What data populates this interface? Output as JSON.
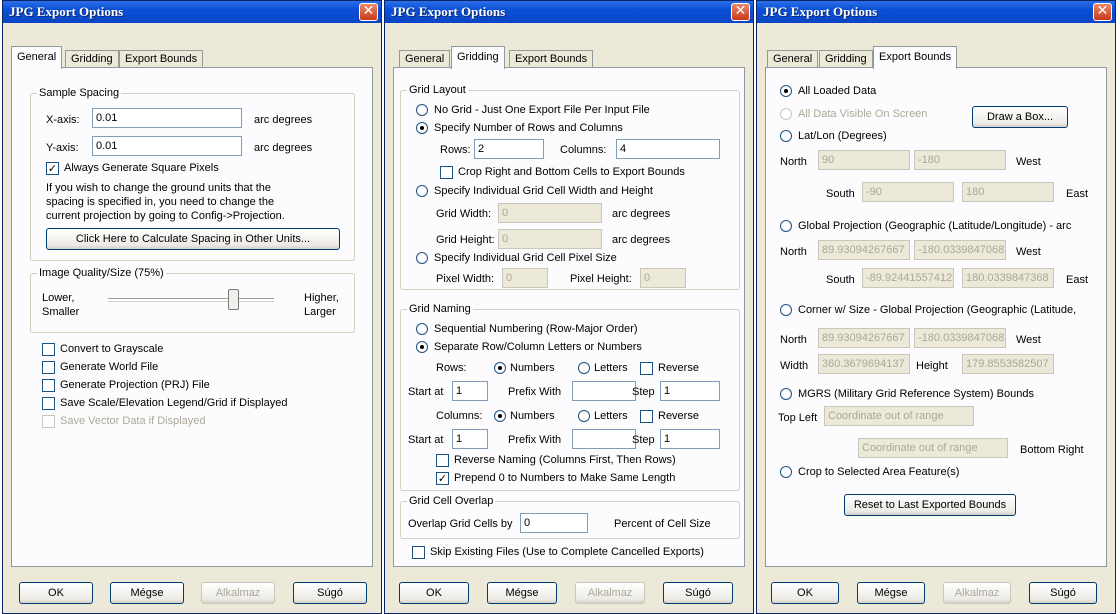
{
  "dialog_title": "JPG Export Options",
  "tabs": [
    "General",
    "Gridding",
    "Export Bounds"
  ],
  "footer": {
    "ok": "OK",
    "cancel": "Mégse",
    "apply": "Alkalmaz",
    "help": "Súgó"
  },
  "general": {
    "sample_spacing": {
      "group": "Sample Spacing",
      "x_label": "X-axis:",
      "x_value": "0.01",
      "x_unit": "arc degrees",
      "y_label": "Y-axis:",
      "y_value": "0.01",
      "y_unit": "arc degrees",
      "square_pixels": "Always Generate Square Pixels",
      "note_1": "If you wish to change the ground units that the",
      "note_2": "spacing is specified in, you need to change the",
      "note_3": "current projection by going to Config->Projection.",
      "calc_button": "Click Here to Calculate Spacing in Other Units..."
    },
    "quality": {
      "group": "Image Quality/Size (75%)",
      "level": 0.75,
      "low_1": "Lower,",
      "low_2": "Smaller",
      "high_1": "Higher,",
      "high_2": "Larger"
    },
    "options": [
      {
        "label": "Convert to Grayscale",
        "checked": false,
        "disabled": false
      },
      {
        "label": "Generate World File",
        "checked": false,
        "disabled": false
      },
      {
        "label": "Generate Projection (PRJ) File",
        "checked": false,
        "disabled": false
      },
      {
        "label": "Save Scale/Elevation Legend/Grid if Displayed",
        "checked": false,
        "disabled": false
      },
      {
        "label": "Save Vector Data if Displayed",
        "checked": false,
        "disabled": true
      }
    ]
  },
  "gridding": {
    "layout": {
      "group": "Grid Layout",
      "no_grid": "No Grid - Just One Export File Per Input File",
      "rows_cols": "Specify Number of Rows and Columns",
      "rows_label": "Rows:",
      "rows_value": "2",
      "cols_label": "Columns:",
      "cols_value": "4",
      "crop": "Crop Right and Bottom Cells to Export Bounds",
      "cell_size": "Specify Individual Grid Cell Width and Height",
      "gw_label": "Grid Width:",
      "gw_value": "0",
      "gw_unit": "arc degrees",
      "gh_label": "Grid Height:",
      "gh_value": "0",
      "gh_unit": "arc degrees",
      "pixel_size": "Specify Individual Grid Cell Pixel Size",
      "pw_label": "Pixel Width:",
      "pw_value": "0",
      "ph_label": "Pixel Height:",
      "ph_value": "0"
    },
    "naming": {
      "group": "Grid Naming",
      "sequential": "Sequential Numbering (Row-Major Order)",
      "separate": "Separate Row/Column Letters or Numbers",
      "rows_label": "Rows:",
      "columns_label": "Columns:",
      "numbers": "Numbers",
      "letters": "Letters",
      "reverse": "Reverse",
      "start_label": "Start at",
      "prefix_label": "Prefix With",
      "step_label": "Step",
      "row_start": "1",
      "row_prefix": "",
      "row_step": "1",
      "col_start": "1",
      "col_prefix": "",
      "col_step": "1",
      "reverse_naming": "Reverse Naming (Columns First, Then Rows)",
      "prepend": "Prepend 0 to Numbers to Make Same Length"
    },
    "overlap": {
      "group": "Grid Cell Overlap",
      "label": "Overlap Grid Cells by",
      "value": "0",
      "unit": "Percent of Cell Size"
    },
    "skip_existing": "Skip Existing Files (Use to Complete Cancelled Exports)"
  },
  "bounds": {
    "all_loaded": "All Loaded Data",
    "all_visible": "All Data Visible On Screen",
    "draw_box": "Draw a Box...",
    "latlon": "Lat/Lon (Degrees)",
    "north": "North",
    "south": "South",
    "west": "West",
    "east": "East",
    "width": "Width",
    "height": "Height",
    "ll_north": "90",
    "ll_west": "-180",
    "ll_south": "-90",
    "ll_east": "180",
    "global": "Global Projection (Geographic (Latitude/Longitude) - arc",
    "gp_north": "89.93094267667",
    "gp_west": "-180.03398470681",
    "gp_south": "-89.92441557412",
    "gp_east": "180.0339847368",
    "corner": "Corner w/ Size - Global Projection (Geographic (Latitude,",
    "cs_north": "89.93094267667",
    "cs_west": "-180.03398470681",
    "cs_width": "360.3679694137",
    "cs_height": "179.8553582507",
    "mgrs": "MGRS (Military Grid Reference System) Bounds",
    "top_left": "Top Left",
    "top_left_value": "Coordinate out of range",
    "bottom_right": "Bottom Right",
    "bottom_right_value": "Coordinate out of range",
    "crop_area": "Crop to Selected Area Feature(s)",
    "reset": "Reset to Last Exported Bounds"
  }
}
